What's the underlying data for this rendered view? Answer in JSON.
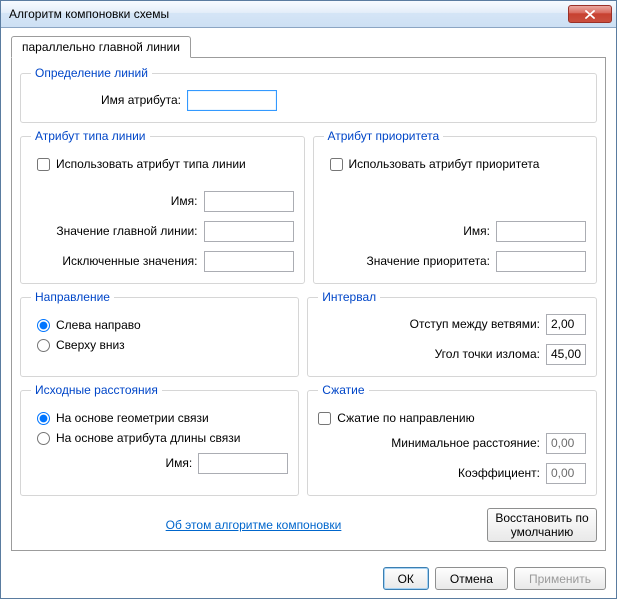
{
  "window": {
    "title": "Алгоритм компоновки схемы"
  },
  "tab": {
    "label": "параллельно главной линии"
  },
  "groups": {
    "lines_def": {
      "legend": "Определение линий",
      "attr_name_label": "Имя атрибута:",
      "attr_name_value": ""
    },
    "line_type": {
      "legend": "Атрибут типа линии",
      "use_label": "Использовать атрибут типа линии",
      "use_checked": false,
      "name_label": "Имя:",
      "name_value": "",
      "main_value_label": "Значение главной линии:",
      "main_value": "",
      "excluded_label": "Исключенные значения:",
      "excluded_value": ""
    },
    "priority": {
      "legend": "Атрибут приоритета",
      "use_label": "Использовать атрибут приоритета",
      "use_checked": false,
      "name_label": "Имя:",
      "name_value": "",
      "value_label": "Значение приоритета:",
      "value": ""
    },
    "direction": {
      "legend": "Направление",
      "opt1": "Слева направо",
      "opt2": "Сверху вниз",
      "selected": "opt1"
    },
    "interval": {
      "legend": "Интервал",
      "branch_label": "Отступ между ветвями:",
      "branch_value": "2,00",
      "break_label": "Угол точки излома:",
      "break_value": "45,00"
    },
    "initdist": {
      "legend": "Исходные расстояния",
      "opt1": "На основе геометрии связи",
      "opt2": "На основе атрибута длины связи",
      "selected": "opt1",
      "name_label": "Имя:",
      "name_value": ""
    },
    "compress": {
      "legend": "Сжатие",
      "use_label": "Сжатие по направлению",
      "use_checked": false,
      "min_label": "Минимальное расстояние:",
      "min_value": "0,00",
      "coef_label": "Коэффициент:",
      "coef_value": "0,00"
    }
  },
  "link": {
    "label": "Об этом алгоритме компоновки"
  },
  "buttons": {
    "restore": "Восстановить по умолчанию",
    "ok": "ОК",
    "cancel": "Отмена",
    "apply": "Применить"
  }
}
